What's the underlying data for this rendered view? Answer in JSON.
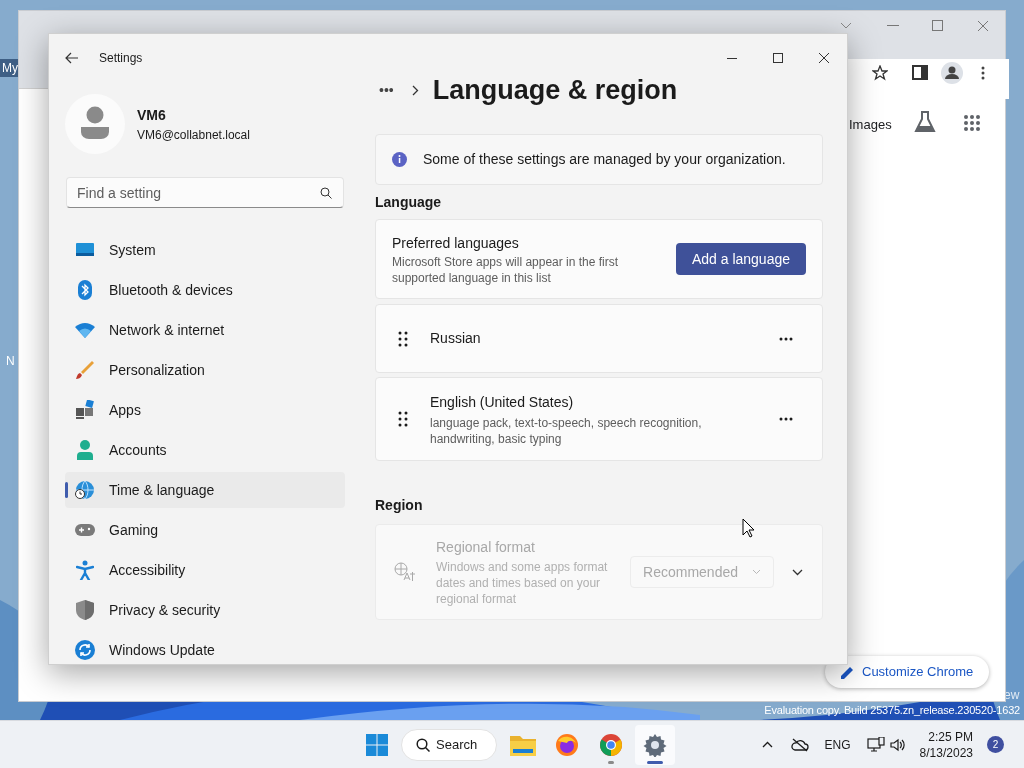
{
  "desktop": {
    "icon_labels": [
      "My",
      "N"
    ],
    "watermark": [
      "ew",
      "Evaluation copy. Build 25375.zn_release.230520-1632"
    ]
  },
  "browser": {
    "toolbar_link": "Images",
    "customize_button": "Customize Chrome"
  },
  "settings": {
    "title": "Settings",
    "user": {
      "name": "VM6",
      "email": "VM6@collabnet.local"
    },
    "search": {
      "placeholder": "Find a setting"
    },
    "nav": [
      {
        "kind": "system",
        "label": "System",
        "selected": false
      },
      {
        "kind": "bluetooth",
        "label": "Bluetooth & devices",
        "selected": false
      },
      {
        "kind": "network",
        "label": "Network & internet",
        "selected": false
      },
      {
        "kind": "personalization",
        "label": "Personalization",
        "selected": false
      },
      {
        "kind": "apps",
        "label": "Apps",
        "selected": false
      },
      {
        "kind": "accounts",
        "label": "Accounts",
        "selected": false
      },
      {
        "kind": "time",
        "label": "Time & language",
        "selected": true
      },
      {
        "kind": "gaming",
        "label": "Gaming",
        "selected": false
      },
      {
        "kind": "accessibility",
        "label": "Accessibility",
        "selected": false
      },
      {
        "kind": "privacy",
        "label": "Privacy & security",
        "selected": false
      },
      {
        "kind": "update",
        "label": "Windows Update",
        "selected": false
      }
    ],
    "breadcrumb": {
      "more": "•••",
      "title": "Language & region"
    },
    "notice": "Some of these settings are managed by your organization.",
    "language": {
      "heading": "Language",
      "preferred": {
        "title": "Preferred languages",
        "description": "Microsoft Store apps will appear in the first supported language in this list",
        "button": "Add a language"
      },
      "languages": [
        {
          "name": "Russian"
        },
        {
          "name": "English (United States)",
          "details": "language pack, text-to-speech, speech recognition, handwriting, basic typing"
        }
      ]
    },
    "region": {
      "heading": "Region",
      "regional_format": {
        "title": "Regional format",
        "description": "Windows and some apps format dates and times based on your regional format",
        "dropdown": "Recommended",
        "disabled": true
      }
    }
  },
  "taskbar": {
    "search": "Search",
    "apps": [
      {
        "kind": "explorer",
        "running": false,
        "selected": false
      },
      {
        "kind": "firefox",
        "running": false,
        "selected": false
      },
      {
        "kind": "chrome",
        "running": true,
        "selected": false
      },
      {
        "kind": "settings",
        "running": true,
        "selected": true
      }
    ],
    "language": "ENG",
    "time": "2:25 PM",
    "date": "8/13/2023",
    "badge": "2"
  }
}
